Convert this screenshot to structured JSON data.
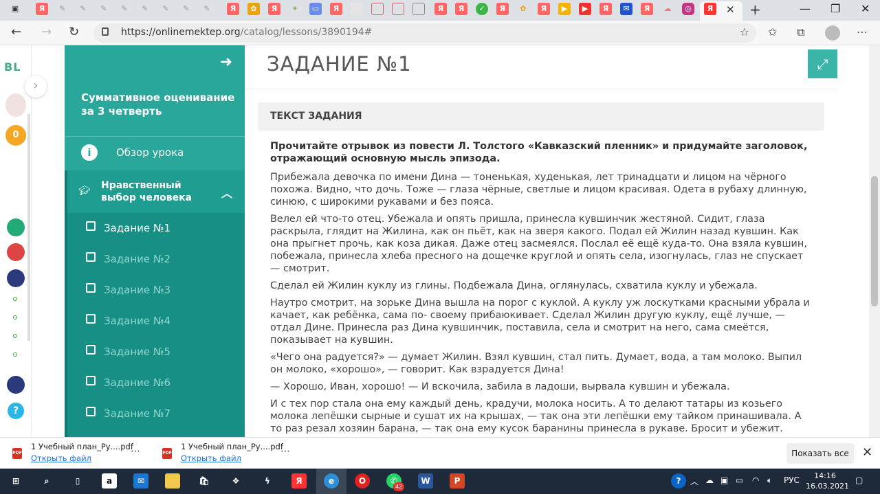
{
  "browser": {
    "url_base": "https://onlinemektep.org",
    "url_path": "/catalog/lessons/3890194#"
  },
  "rail": {
    "logo": "BL",
    "coins": "0",
    "help": "?"
  },
  "sidebar": {
    "course_title": "Суммативное оценивание за 3 четверть",
    "overview_label": "Обзор урока",
    "section_label": "Нравственный выбор человека",
    "tasks": [
      "Задание №1",
      "Задание №2",
      "Задание №3",
      "Задание №4",
      "Задание №5",
      "Задание №6",
      "Задание №7"
    ]
  },
  "main": {
    "page_title": "ЗАДАНИЕ №1",
    "task_box_label": "ТЕКСТ ЗАДАНИЯ",
    "question": "Прочитайте отрывок из повести Л. Толстого «Кавказский пленник» и придумайте заголовок, отражающий основную мысль эпизода.",
    "paragraphs": [
      "Прибежала девочка по имени Дина — тоненькая, худенькая, лет тринадцати и лицом на чёрного похожа. Видно, что дочь. Тоже — глаза чёрные, светлые и лицом красивая. Одета в рубаху длинную, синюю, с широкими рукавами и без пояса.",
      "Велел ей что-то отец. Убежала и опять пришла, принесла кувшинчик жестяной. Сидит, глаза раскрыла, глядит на Жилина, как он пьёт, как на зверя какого. Подал ей Жилин назад кувшин. Как она прыгнет прочь, как коза дикая. Даже отец засмеялся. Послал её ещё куда-то. Она взяла кувшин, побежала, принесла хлеба пресного на дощечке круглой и опять села, изогнулась, глаз не спускает — смотрит.",
      "Сделал ей Жилин куклу из глины. Подбежала Дина, оглянулась, схватила куклу и убежала.",
      "Наутро смотрит, на зорьке Дина вышла на порог с куклой. А куклу уж лоскутками красными убрала и качает, как ребёнка, сама по- своему прибаюкивает. Сделал Жилин другую куклу, ещё лучше, — отдал Дине. Принесла раз Дина кувшинчик, поставила, села и смотрит на него, сама смеётся, показывает на кувшин.",
      "«Чего она радуется?» — думает Жилин. Взял кувшин, стал пить. Думает, вода, а там молоко. Выпил он молоко, «хорошо», — говорит. Как взрадуется Дина!",
      "— Хорошо, Иван, хорошо! — И вскочила, забила в ладоши, вырвала кувшин и убежала.",
      "И с тех пор стала она ему каждый день, крадучи, молока носить. А то делают татары из козьего молока лепёшки сырные и сушат их на крышах, — так она эти лепёшки ему тайком принашивала. А то раз резал хозяин барана, — так она ему кусок баранины принесла в рукаве. Бросит и убежит."
    ]
  },
  "downloads": {
    "items": [
      {
        "name": "1 Учебный план_Ру....pdf",
        "open": "Открыть файл"
      },
      {
        "name": "1 Учебный план_Ру....pdf",
        "open": "Открыть файл"
      }
    ],
    "show_all": "Показать все"
  },
  "taskbar": {
    "whatsapp_badge": "42",
    "lang": "РУС",
    "time": "14:16",
    "date": "16.03.2021"
  }
}
